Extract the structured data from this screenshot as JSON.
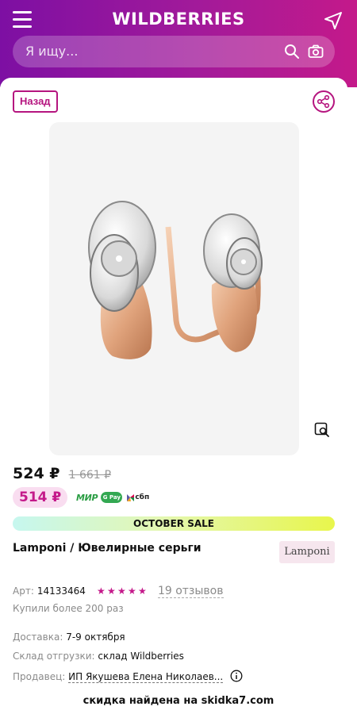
{
  "header": {
    "logo": "WILDBERRIES",
    "search_placeholder": "Я ищу...",
    "brand_gradient": [
      "#7d0fa3",
      "#c4198a"
    ]
  },
  "toolbar": {
    "back_label": "Назад"
  },
  "product": {
    "price": "524 ₽",
    "old_price": "1 661 ₽",
    "wallet_price": "514 ₽",
    "payment": {
      "mir": "МИР",
      "gpay": "G Pay",
      "sbp": "сбп"
    },
    "sale_banner": "OCTOBER SALE",
    "title": "Lamponi / Ювелирные серьги",
    "brand": "Lamponi",
    "article_label": "Арт:",
    "article": "14133464",
    "rating": 5,
    "reviews": "19 отзывов",
    "bought": "Купили более 200 раз"
  },
  "delivery": {
    "delivery_label": "Доставка:",
    "delivery_value": "7-9 октября",
    "warehouse_label": "Склад отгрузки:",
    "warehouse_value": "склад Wildberries",
    "seller_label": "Продавец:",
    "seller_value": "ИП Якушева Елена Николаев..."
  },
  "promo": "скидка найдена на skidka7.com",
  "colors": {
    "accent": "#c4198a",
    "accent_dark": "#b5157f"
  }
}
